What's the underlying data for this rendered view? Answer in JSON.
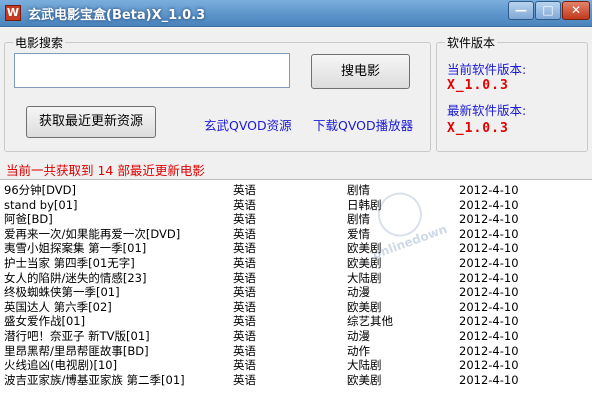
{
  "window": {
    "icon_letter": "W",
    "title": "玄武电影宝盒(Beta)X_1.0.3",
    "min_glyph": "—",
    "max_glyph": "□",
    "close_glyph": "✕"
  },
  "search": {
    "group_label": "电影搜索",
    "input_value": "",
    "search_button": "搜电影",
    "refresh_button": "获取最近更新资源"
  },
  "links": {
    "qvod_resources": "玄武QVOD资源",
    "download_qvod": "下载QVOD播放器"
  },
  "version": {
    "group_label": "软件版本",
    "current_label": "当前软件版本:",
    "current_value": "X_1.0.3",
    "latest_label": "最新软件版本:",
    "latest_value": "X_1.0.3"
  },
  "status_text": "当前一共获取到 14 部最近更新电影",
  "movies": [
    {
      "title": "96分钟[DVD]",
      "lang": "英语",
      "genre": "剧情",
      "date": "2012-4-10"
    },
    {
      "title": "stand by[01]",
      "lang": "英语",
      "genre": "日韩剧",
      "date": "2012-4-10"
    },
    {
      "title": "阿爸[BD]",
      "lang": "英语",
      "genre": "剧情",
      "date": "2012-4-10"
    },
    {
      "title": "爱再来一次/如果能再爱一次[DVD]",
      "lang": "英语",
      "genre": "爱情",
      "date": "2012-4-10"
    },
    {
      "title": "夷雪小姐探案集 第一季[01]",
      "lang": "英语",
      "genre": "欧美剧",
      "date": "2012-4-10"
    },
    {
      "title": "护士当家 第四季[01无字]",
      "lang": "英语",
      "genre": "欧美剧",
      "date": "2012-4-10"
    },
    {
      "title": "女人的陷阱/迷失的情感[23]",
      "lang": "英语",
      "genre": "大陆剧",
      "date": "2012-4-10"
    },
    {
      "title": "终极蜘蛛侠第一季[01]",
      "lang": "英语",
      "genre": "动漫",
      "date": "2012-4-10"
    },
    {
      "title": "英国达人 第六季[02]",
      "lang": "英语",
      "genre": "欧美剧",
      "date": "2012-4-10"
    },
    {
      "title": "盛女爱作战[01]",
      "lang": "英语",
      "genre": "综艺其他",
      "date": "2012-4-10"
    },
    {
      "title": "潜行吧！奈亚子 新TV版[01]",
      "lang": "英语",
      "genre": "动漫",
      "date": "2012-4-10"
    },
    {
      "title": "里昂黑帮/里昂帮匪故事[BD]",
      "lang": "英语",
      "genre": "动作",
      "date": "2012-4-10"
    },
    {
      "title": "火线追凶(电视剧)[10]",
      "lang": "英语",
      "genre": "大陆剧",
      "date": "2012-4-10"
    },
    {
      "title": "波吉亚家族/博基亚家族 第二季[01]",
      "lang": "英语",
      "genre": "欧美剧",
      "date": "2012-4-10"
    }
  ],
  "watermark_text": "onlinedown"
}
